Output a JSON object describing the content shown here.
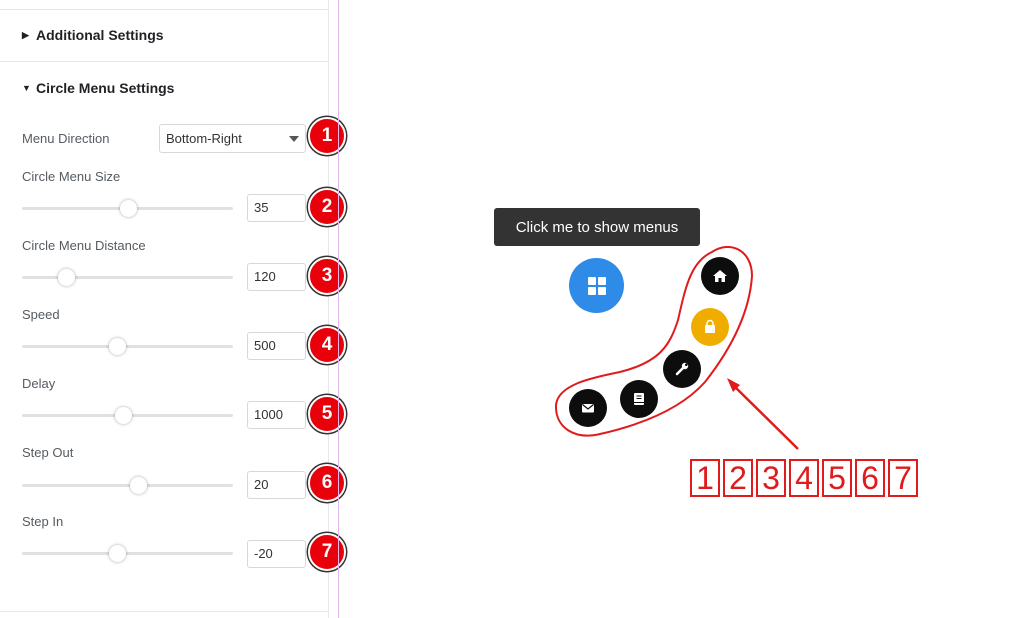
{
  "panel": {
    "additional_settings": "Additional Settings",
    "circle_menu_settings": "Circle Menu Settings",
    "menu_direction": {
      "label": "Menu Direction",
      "value": "Bottom-Right",
      "badge": "1"
    },
    "sliders": [
      {
        "label": "Circle Menu Size",
        "value": "35",
        "level": 0.5,
        "badge": "2"
      },
      {
        "label": "Circle Menu Distance",
        "value": "120",
        "level": 0.21,
        "badge": "3"
      },
      {
        "label": "Speed",
        "value": "500",
        "level": 0.45,
        "badge": "4"
      },
      {
        "label": "Delay",
        "value": "1000",
        "level": 0.48,
        "badge": "5"
      },
      {
        "label": "Step Out",
        "value": "20",
        "level": 0.55,
        "badge": "6"
      },
      {
        "label": "Step In",
        "value": "-20",
        "level": 0.45,
        "badge": "7"
      }
    ]
  },
  "preview": {
    "tooltip": "Click me to show menus",
    "main_icon": "grid-icon",
    "menu_items": [
      {
        "icon": "home-icon",
        "color": "#0d0d0d"
      },
      {
        "icon": "bag-icon",
        "color": "#f0ad00"
      },
      {
        "icon": "wrench-icon",
        "color": "#0d0d0d"
      },
      {
        "icon": "book-icon",
        "color": "#0d0d0d"
      },
      {
        "icon": "mail-icon",
        "color": "#0d0d0d"
      }
    ],
    "annotation_numbers": [
      "1",
      "2",
      "3",
      "4",
      "5",
      "6",
      "7"
    ],
    "annotation_color": "#e01b1b"
  }
}
